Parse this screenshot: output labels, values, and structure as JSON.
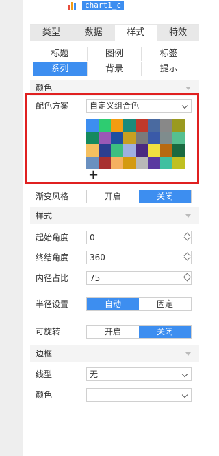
{
  "header": {
    "chart_name": "chart1_c"
  },
  "main_tabs": [
    {
      "label": "类型",
      "active": false
    },
    {
      "label": "数据",
      "active": false
    },
    {
      "label": "样式",
      "active": true
    },
    {
      "label": "特效",
      "active": false
    }
  ],
  "sub_tabs": [
    {
      "label": "标题",
      "active": false
    },
    {
      "label": "图例",
      "active": false
    },
    {
      "label": "标签",
      "active": false
    },
    {
      "label": "系列",
      "active": true
    },
    {
      "label": "背景",
      "active": false
    },
    {
      "label": "提示",
      "active": false
    }
  ],
  "color_section": {
    "title": "颜色",
    "scheme_label": "配色方案",
    "scheme_value": "自定义组合色",
    "swatches": [
      "#3d8ef0",
      "#2ecc71",
      "#f39c12",
      "#1a8a7a",
      "#c0392b",
      "#4a6aa0",
      "#888888",
      "#9a9a20",
      "#158a5e",
      "#9b59b6",
      "#1e4fa0",
      "#c8a020",
      "#7a7a7a",
      "#3a5aa8",
      "#7f8c8d",
      "#55c090",
      "#f5c060",
      "#2c3e90",
      "#3dbe80",
      "#9fb0e0",
      "#4a2a80",
      "#f0e040",
      "#b86a10",
      "#1a6a40",
      "#6a90c0",
      "#a83030",
      "#f5b060",
      "#d49a10",
      "#b8b8b8",
      "#5a3aa0",
      "#40c0a0",
      "#c0c020"
    ],
    "add_symbol": "+"
  },
  "gradient": {
    "label": "渐变风格",
    "options": [
      "开启",
      "关闭"
    ],
    "selected": "关闭"
  },
  "style_section": {
    "title": "样式",
    "start_angle": {
      "label": "起始角度",
      "value": "0"
    },
    "end_angle": {
      "label": "终结角度",
      "value": "360"
    },
    "inner_ratio": {
      "label": "内径占比",
      "value": "75"
    },
    "radius": {
      "label": "半径设置",
      "options": [
        "自动",
        "固定"
      ],
      "selected": "自动"
    },
    "rotatable": {
      "label": "可旋转",
      "options": [
        "开启",
        "关闭"
      ],
      "selected": "关闭"
    }
  },
  "border_section": {
    "title": "边框",
    "line_type_label": "线型",
    "line_type_value": "无",
    "color_label": "颜色",
    "color_value": ""
  },
  "colors": {
    "accent": "#3d8ef0",
    "highlight": "#e02020"
  }
}
